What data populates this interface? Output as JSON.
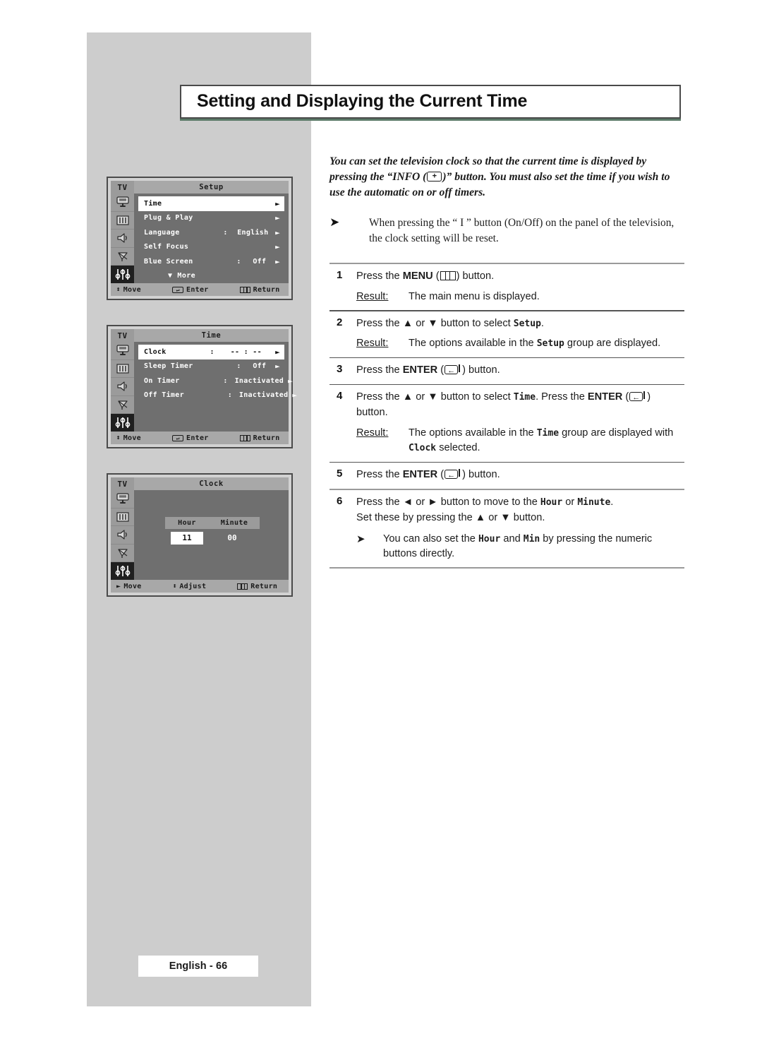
{
  "page": {
    "title": "Setting and Displaying the Current Time",
    "footer": "English - 66"
  },
  "intro": {
    "part1": "You can set the television clock so that the current time is displayed by pressing the “INFO (",
    "part2": ")” button. You must also set the time if you wish to use the automatic on or off timers."
  },
  "note": {
    "arrow": "➤",
    "text": "When pressing the “ I ” button (On/Off) on the panel of the television, the clock setting will be reset."
  },
  "steps": [
    {
      "num": "1",
      "line_pre": "Press the ",
      "line_bold": "MENU",
      "line_mid": " (",
      "line_post": ")  button.",
      "result_label": "Result:",
      "result_pre": "The main menu is displayed.",
      "result_mono": "",
      "result_post": ""
    },
    {
      "num": "2",
      "line_pre": "Press the ▲ or ▼ button to select ",
      "line_bold": "",
      "line_mono": "Setup",
      "line_post": ".",
      "result_label": "Result:",
      "result_pre": "The options available in the ",
      "result_mono": "Setup",
      "result_post": " group are displayed."
    },
    {
      "num": "3",
      "line_pre": "Press the ",
      "line_bold": "ENTER",
      "line_mid": " (",
      "line_post": ") button."
    },
    {
      "num": "4",
      "line_pre": "Press the ▲ or ▼ button to select ",
      "line_mono": "Time",
      "line_mid2": ". Press the ",
      "line_bold": "ENTER",
      "line_mid": " (",
      "line_post": ") button.",
      "result_label": "Result:",
      "result_pre": "The options available in the ",
      "result_mono": "Time",
      "result_post": " group are displayed with ",
      "result_mono2": "Clock",
      "result_post2": " selected."
    },
    {
      "num": "5",
      "line_pre": "Press the ",
      "line_bold": "ENTER",
      "line_mid": " (",
      "line_post": ") button."
    },
    {
      "num": "6",
      "line_pre": "Press the ◄ or ► button to move to the ",
      "line_mono": "Hour",
      "line_mid2": " or ",
      "line_mono2": "Minute",
      "line_post": ".",
      "line2": "Set these by pressing the ▲ or ▼ button.",
      "note_arrow": "➤",
      "note_pre": "You can also set the ",
      "note_mono": "Hour",
      "note_mid": " and ",
      "note_mono2": "Min",
      "note_post": " by pressing the numeric buttons directly."
    }
  ],
  "osd": {
    "tv_label": "TV",
    "bottom_bar": {
      "move": "Move",
      "enter": "Enter",
      "return": "Return",
      "adjust": "Adjust"
    },
    "arrow": "►",
    "setup_menu": {
      "heading": "Setup",
      "rows": [
        {
          "label": "Time",
          "colon": "",
          "value": "",
          "arrow": "►",
          "selected": true
        },
        {
          "label": "Plug & Play",
          "colon": "",
          "value": "",
          "arrow": "►",
          "selected": false
        },
        {
          "label": "Language",
          "colon": ":",
          "value": "English",
          "arrow": "►",
          "selected": false
        },
        {
          "label": "Self Focus",
          "colon": "",
          "value": "",
          "arrow": "►",
          "selected": false
        },
        {
          "label": "Blue Screen",
          "colon": ":",
          "value": "Off",
          "arrow": "►",
          "selected": false
        }
      ],
      "more": "More",
      "more_tri": "▼"
    },
    "time_menu": {
      "heading": "Time",
      "rows": [
        {
          "label": "Clock",
          "colon": ":",
          "value": "-- : --",
          "arrow": "►",
          "selected": true
        },
        {
          "label": "Sleep Timer",
          "colon": ":",
          "value": "Off",
          "arrow": "►",
          "selected": false
        },
        {
          "label": "On Timer",
          "colon": ":",
          "value": "Inactivated",
          "arrow": "►",
          "selected": false
        },
        {
          "label": "Off Timer",
          "colon": ":",
          "value": "Inactivated",
          "arrow": "►",
          "selected": false
        }
      ]
    },
    "clock_menu": {
      "heading": "Clock",
      "hour_label": "Hour",
      "minute_label": "Minute",
      "hour_value": "11",
      "minute_value": "00",
      "move": "Move",
      "move_tri": "►"
    }
  },
  "colors": {
    "page_band": "#cdcdcd",
    "osd_body": "#6f6f6f",
    "osd_rail": "#9b9b9b",
    "osd_bar": "#a8a8a8",
    "title_shadow": "#5b7a68"
  }
}
